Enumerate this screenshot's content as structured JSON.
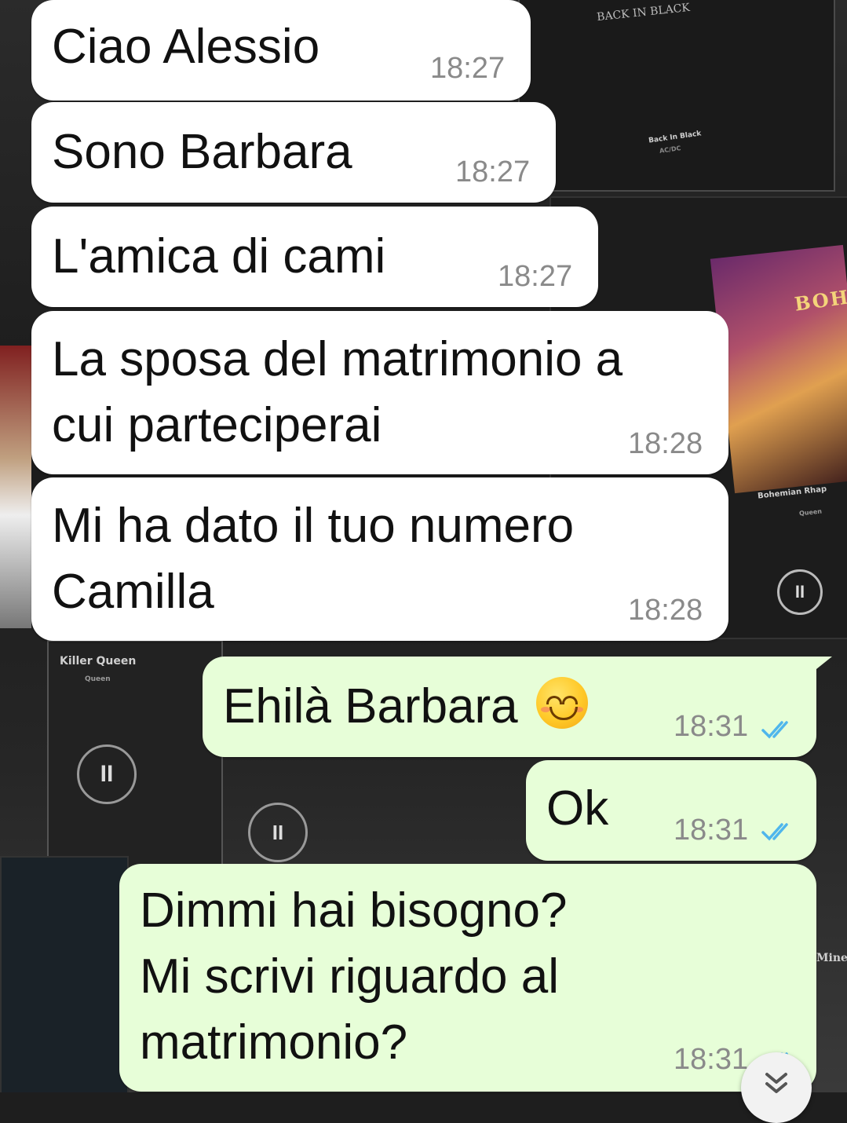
{
  "colors": {
    "incoming_bubble": "#ffffff",
    "outgoing_bubble": "#e7fed8",
    "timestamp": "#8a8a8a",
    "read_ticks": "#4fb6ec"
  },
  "messages": [
    {
      "direction": "incoming",
      "text": "Ciao Alessio",
      "time": "18:27"
    },
    {
      "direction": "incoming",
      "text": "Sono Barbara",
      "time": "18:27"
    },
    {
      "direction": "incoming",
      "text": "L'amica di cami",
      "time": "18:27"
    },
    {
      "direction": "incoming",
      "text": "La sposa del matrimonio a\ncui parteciperai",
      "time": "18:28"
    },
    {
      "direction": "incoming",
      "text": "Mi ha dato il tuo numero\nCamilla",
      "time": "18:28"
    },
    {
      "direction": "outgoing",
      "text": "Ehilà Barbara",
      "emoji": "smiling-face-icon",
      "time": "18:31",
      "status": "read"
    },
    {
      "direction": "outgoing",
      "text": "Ok",
      "time": "18:31",
      "status": "read"
    },
    {
      "direction": "outgoing",
      "text": "Dimmi hai bisogno?\nMi scrivi riguardo al\nmatrimonio?",
      "time": "18:31",
      "status": "read"
    }
  ],
  "wallpaper": {
    "type": "album-cover-collage",
    "texts": {
      "back_in_black": "BACK IN BLACK",
      "back_in_black_small": "Back In Black",
      "acdc": "AC/DC",
      "boh": "BOH",
      "bohemian": "Bohemian Rhap",
      "queen": "Queen",
      "killer_queen": "Killer Queen",
      "killer_queen_artist": "Queen",
      "mine": "Mine"
    }
  },
  "scroll_button_icon": "double-chevron-down-icon"
}
